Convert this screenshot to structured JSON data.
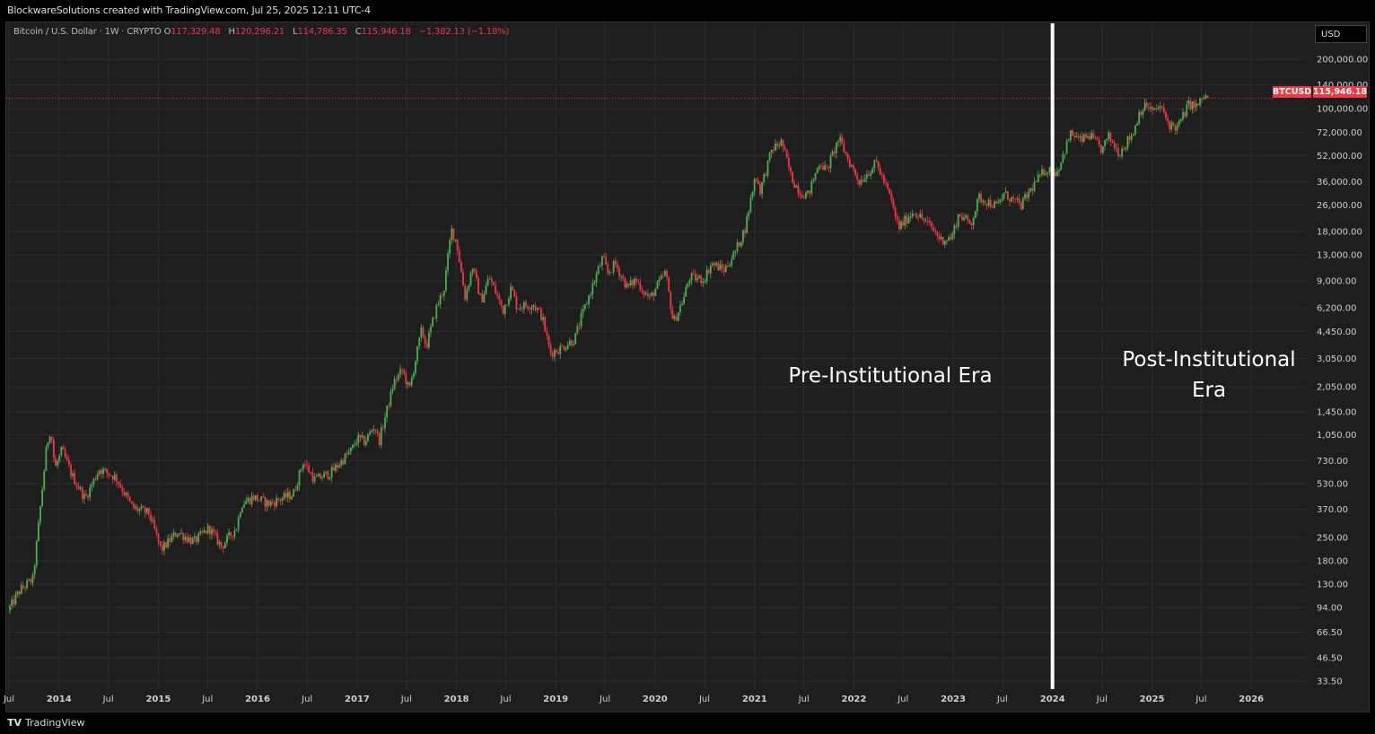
{
  "header": {
    "attribution": "BlockwareSolutions created with TradingView.com, Jul 25, 2025 12:11 UTC-4"
  },
  "legend": {
    "symbol": "Bitcoin / U.S. Dollar · 1W · CRYPTO",
    "open_label": "O",
    "open": "117,329.48",
    "high_label": "H",
    "high": "120,296.21",
    "low_label": "L",
    "low": "114,786.35",
    "close_label": "C",
    "close": "115,946.18",
    "change": "−1,382.13 (−1.18%)"
  },
  "currency_button": "USD",
  "price_tag": {
    "symbol": "BTCUSD",
    "value": "115,946.18"
  },
  "footer": {
    "logo": "TV",
    "brand": "TradingView"
  },
  "colors": {
    "up": "#26a69a",
    "up_green": "#4caf50",
    "down": "#f23645",
    "background": "#1e1e1e",
    "divider": "#ffffff"
  },
  "annotations": {
    "pre": "Pre-Institutional Era",
    "post_line1": "Post-Institutional",
    "post_line2": "Era"
  },
  "chart_data": {
    "type": "candlestick",
    "scale": "log",
    "ylim": [
      30,
      260000
    ],
    "xlim": [
      "2013-07-01",
      "2026-06-01"
    ],
    "y_ticks": [
      {
        "value": 200000,
        "label": "200,000.00"
      },
      {
        "value": 140000,
        "label": "140,000.00"
      },
      {
        "value": 100000,
        "label": "100,000.00"
      },
      {
        "value": 72000,
        "label": "72,000.00"
      },
      {
        "value": 52000,
        "label": "52,000.00"
      },
      {
        "value": 36000,
        "label": "36,000.00"
      },
      {
        "value": 26000,
        "label": "26,000.00"
      },
      {
        "value": 18000,
        "label": "18,000.00"
      },
      {
        "value": 13000,
        "label": "13,000.00"
      },
      {
        "value": 9000,
        "label": "9,000.00"
      },
      {
        "value": 6200,
        "label": "6,200.00"
      },
      {
        "value": 4450,
        "label": "4,450.00"
      },
      {
        "value": 3050,
        "label": "3,050.00"
      },
      {
        "value": 2050,
        "label": "2,050.00"
      },
      {
        "value": 1450,
        "label": "1,450.00"
      },
      {
        "value": 1050,
        "label": "1,050.00"
      },
      {
        "value": 730,
        "label": "730.00"
      },
      {
        "value": 530,
        "label": "530.00"
      },
      {
        "value": 370,
        "label": "370.00"
      },
      {
        "value": 250,
        "label": "250.00"
      },
      {
        "value": 180,
        "label": "180.00"
      },
      {
        "value": 130,
        "label": "130.00"
      },
      {
        "value": 94,
        "label": "94.00"
      },
      {
        "value": 66.5,
        "label": "66.50"
      },
      {
        "value": 46.5,
        "label": "46.50"
      },
      {
        "value": 33.5,
        "label": "33.50"
      }
    ],
    "x_ticks": [
      {
        "t": "2013-07-01",
        "label": "Jul"
      },
      {
        "t": "2014-01-01",
        "label": "2014"
      },
      {
        "t": "2014-07-01",
        "label": "Jul"
      },
      {
        "t": "2015-01-01",
        "label": "2015"
      },
      {
        "t": "2015-07-01",
        "label": "Jul"
      },
      {
        "t": "2016-01-01",
        "label": "2016"
      },
      {
        "t": "2016-07-01",
        "label": "Jul"
      },
      {
        "t": "2017-01-01",
        "label": "2017"
      },
      {
        "t": "2017-07-01",
        "label": "Jul"
      },
      {
        "t": "2018-01-01",
        "label": "2018"
      },
      {
        "t": "2018-07-01",
        "label": "Jul"
      },
      {
        "t": "2019-01-01",
        "label": "2019"
      },
      {
        "t": "2019-07-01",
        "label": "Jul"
      },
      {
        "t": "2020-01-01",
        "label": "2020"
      },
      {
        "t": "2020-07-01",
        "label": "Jul"
      },
      {
        "t": "2021-01-01",
        "label": "2021"
      },
      {
        "t": "2021-07-01",
        "label": "Jul"
      },
      {
        "t": "2022-01-01",
        "label": "2022"
      },
      {
        "t": "2022-07-01",
        "label": "Jul"
      },
      {
        "t": "2023-01-01",
        "label": "2023"
      },
      {
        "t": "2023-07-01",
        "label": "Jul"
      },
      {
        "t": "2024-01-01",
        "label": "2024"
      },
      {
        "t": "2024-07-01",
        "label": "Jul"
      },
      {
        "t": "2025-01-01",
        "label": "2025"
      },
      {
        "t": "2025-07-01",
        "label": "Jul"
      },
      {
        "t": "2026-01-01",
        "label": "2026"
      }
    ],
    "last_price": 115946.18,
    "divider_date": "2024-01-01",
    "price_path": [
      [
        "2013-07-01",
        90
      ],
      [
        "2013-08-15",
        120
      ],
      [
        "2013-10-01",
        140
      ],
      [
        "2013-11-20",
        900
      ],
      [
        "2013-12-05",
        1150
      ],
      [
        "2013-12-20",
        650
      ],
      [
        "2014-01-15",
        850
      ],
      [
        "2014-02-20",
        600
      ],
      [
        "2014-04-10",
        430
      ],
      [
        "2014-06-01",
        650
      ],
      [
        "2014-08-01",
        580
      ],
      [
        "2014-10-01",
        380
      ],
      [
        "2014-12-01",
        350
      ],
      [
        "2015-01-15",
        210
      ],
      [
        "2015-03-15",
        270
      ],
      [
        "2015-05-15",
        235
      ],
      [
        "2015-07-10",
        285
      ],
      [
        "2015-08-25",
        220
      ],
      [
        "2015-10-20",
        290
      ],
      [
        "2015-11-05",
        400
      ],
      [
        "2015-12-20",
        440
      ],
      [
        "2016-02-15",
        400
      ],
      [
        "2016-05-15",
        460
      ],
      [
        "2016-06-20",
        720
      ],
      [
        "2016-08-01",
        560
      ],
      [
        "2016-10-01",
        620
      ],
      [
        "2016-12-15",
        850
      ],
      [
        "2017-01-05",
        1000
      ],
      [
        "2017-02-01",
        950
      ],
      [
        "2017-03-10",
        1200
      ],
      [
        "2017-03-25",
        950
      ],
      [
        "2017-05-20",
        2200
      ],
      [
        "2017-06-20",
        2600
      ],
      [
        "2017-07-15",
        1950
      ],
      [
        "2017-08-30",
        4600
      ],
      [
        "2017-09-15",
        3600
      ],
      [
        "2017-10-20",
        6000
      ],
      [
        "2017-11-20",
        8200
      ],
      [
        "2017-12-17",
        18500
      ],
      [
        "2018-01-05",
        15500
      ],
      [
        "2018-02-05",
        7200
      ],
      [
        "2018-03-05",
        11000
      ],
      [
        "2018-04-05",
        6800
      ],
      [
        "2018-05-05",
        9500
      ],
      [
        "2018-06-25",
        6000
      ],
      [
        "2018-07-25",
        8200
      ],
      [
        "2018-08-15",
        6300
      ],
      [
        "2018-10-15",
        6500
      ],
      [
        "2018-11-15",
        5500
      ],
      [
        "2018-12-15",
        3300
      ],
      [
        "2019-01-20",
        3500
      ],
      [
        "2019-03-15",
        4000
      ],
      [
        "2019-04-05",
        5200
      ],
      [
        "2019-05-15",
        8000
      ],
      [
        "2019-06-26",
        12500
      ],
      [
        "2019-07-15",
        10000
      ],
      [
        "2019-08-10",
        11500
      ],
      [
        "2019-09-25",
        8200
      ],
      [
        "2019-10-25",
        9200
      ],
      [
        "2019-12-15",
        7000
      ],
      [
        "2020-02-12",
        10200
      ],
      [
        "2020-03-12",
        5000
      ],
      [
        "2020-04-20",
        7200
      ],
      [
        "2020-05-10",
        9500
      ],
      [
        "2020-07-01",
        9200
      ],
      [
        "2020-07-30",
        11500
      ],
      [
        "2020-09-15",
        10500
      ],
      [
        "2020-10-25",
        13500
      ],
      [
        "2020-12-01",
        19000
      ],
      [
        "2021-01-08",
        40000
      ],
      [
        "2021-01-25",
        32000
      ],
      [
        "2021-03-10",
        57000
      ],
      [
        "2021-04-14",
        63000
      ],
      [
        "2021-05-20",
        38000
      ],
      [
        "2021-06-22",
        31000
      ],
      [
        "2021-07-20",
        30000
      ],
      [
        "2021-09-01",
        48000
      ],
      [
        "2021-09-25",
        42000
      ],
      [
        "2021-11-10",
        66000
      ],
      [
        "2021-12-20",
        47000
      ],
      [
        "2022-01-25",
        36000
      ],
      [
        "2022-03-28",
        47000
      ],
      [
        "2022-05-15",
        30000
      ],
      [
        "2022-06-18",
        19000
      ],
      [
        "2022-08-12",
        24000
      ],
      [
        "2022-10-15",
        19200
      ],
      [
        "2022-11-20",
        16000
      ],
      [
        "2022-12-30",
        16500
      ],
      [
        "2023-01-25",
        23000
      ],
      [
        "2023-03-10",
        20000
      ],
      [
        "2023-04-10",
        29000
      ],
      [
        "2023-06-15",
        25500
      ],
      [
        "2023-07-10",
        30500
      ],
      [
        "2023-09-10",
        25800
      ],
      [
        "2023-10-25",
        34000
      ],
      [
        "2023-12-10",
        43000
      ],
      [
        "2024-01-20",
        41000
      ],
      [
        "2024-03-12",
        71000
      ],
      [
        "2024-04-15",
        64000
      ],
      [
        "2024-05-20",
        69000
      ],
      [
        "2024-07-05",
        56000
      ],
      [
        "2024-07-28",
        68000
      ],
      [
        "2024-09-05",
        54000
      ],
      [
        "2024-10-28",
        72000
      ],
      [
        "2024-11-20",
        97000
      ],
      [
        "2024-12-17",
        105000
      ],
      [
        "2025-01-10",
        95000
      ],
      [
        "2025-02-01",
        104000
      ],
      [
        "2025-03-10",
        80000
      ],
      [
        "2025-04-08",
        77000
      ],
      [
        "2025-05-20",
        107000
      ],
      [
        "2025-06-20",
        103000
      ],
      [
        "2025-07-14",
        119000
      ],
      [
        "2025-07-25",
        115946
      ]
    ]
  }
}
